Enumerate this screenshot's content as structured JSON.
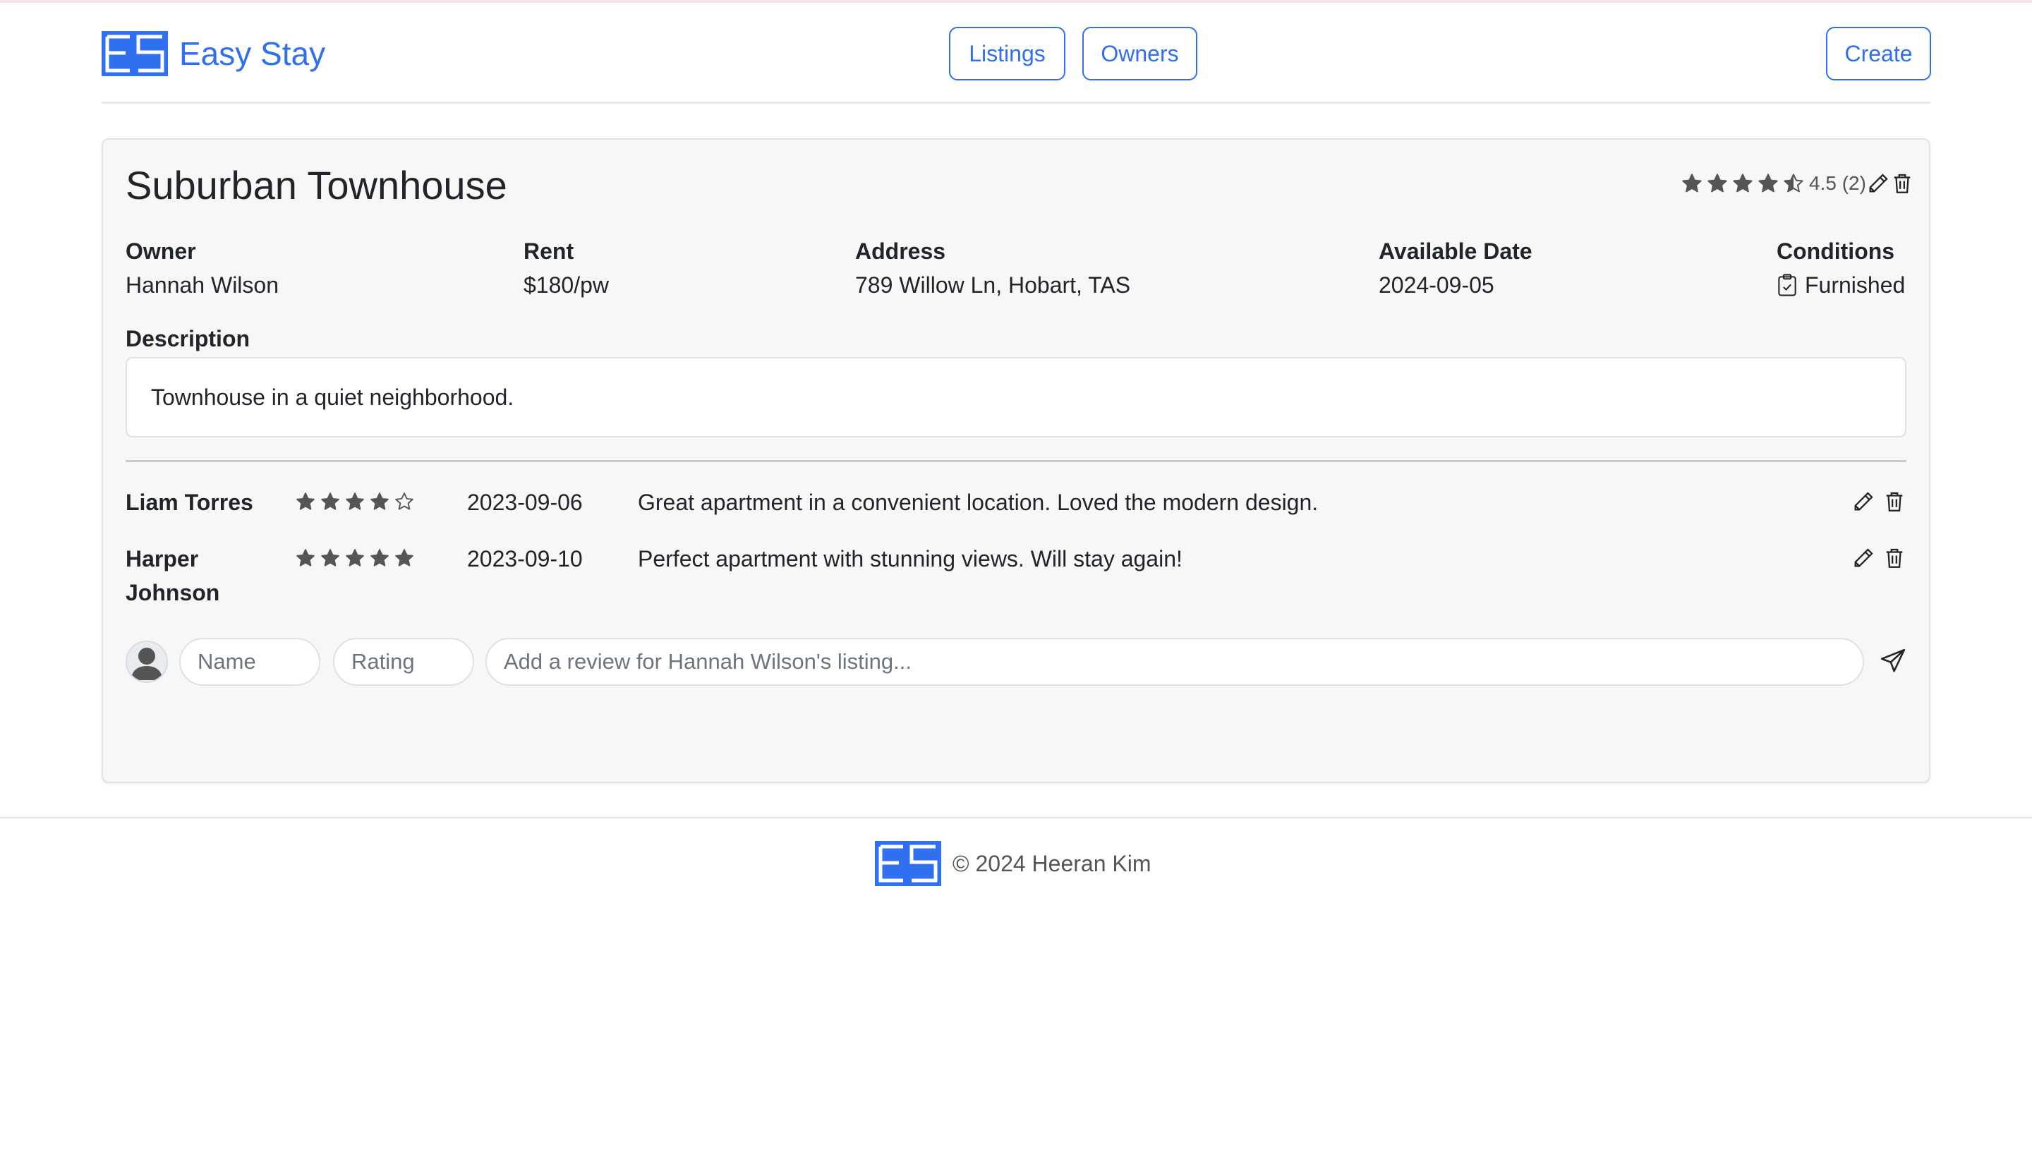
{
  "colors": {
    "accent": "#2f6ff0",
    "star": "#555555",
    "card_bg": "#f7f7f8"
  },
  "brand": {
    "name": "Easy Stay",
    "logo_text": "ES"
  },
  "nav": {
    "listings": "Listings",
    "owners": "Owners",
    "create": "Create"
  },
  "listing": {
    "title": "Suburban Townhouse",
    "rating": 4.5,
    "rating_text": "4.5 (2)",
    "fields": {
      "owner_label": "Owner",
      "owner": "Hannah Wilson",
      "rent_label": "Rent",
      "rent": "$180/pw",
      "address_label": "Address",
      "address": "789 Willow Ln, Hobart, TAS",
      "date_label": "Available Date",
      "date": "2024-09-05",
      "conditions_label": "Conditions",
      "conditions": "Furnished"
    },
    "description_label": "Description",
    "description": "Townhouse in a quiet neighborhood."
  },
  "reviews": [
    {
      "name": "Liam Torres",
      "rating": 4,
      "date": "2023-09-06",
      "text": "Great apartment in a convenient location. Loved the modern design."
    },
    {
      "name": "Harper Johnson",
      "rating": 5,
      "date": "2023-09-10",
      "text": "Perfect apartment with stunning views. Will stay again!"
    }
  ],
  "compose": {
    "name_placeholder": "Name",
    "rating_placeholder": "Rating",
    "review_placeholder": "Add a review for Hannah Wilson's listing..."
  },
  "footer": {
    "text": "© 2024 Heeran Kim"
  },
  "icons": [
    "star-icon",
    "pencil-icon",
    "trash-icon",
    "clipboard-check-icon",
    "person-icon",
    "send-icon"
  ]
}
